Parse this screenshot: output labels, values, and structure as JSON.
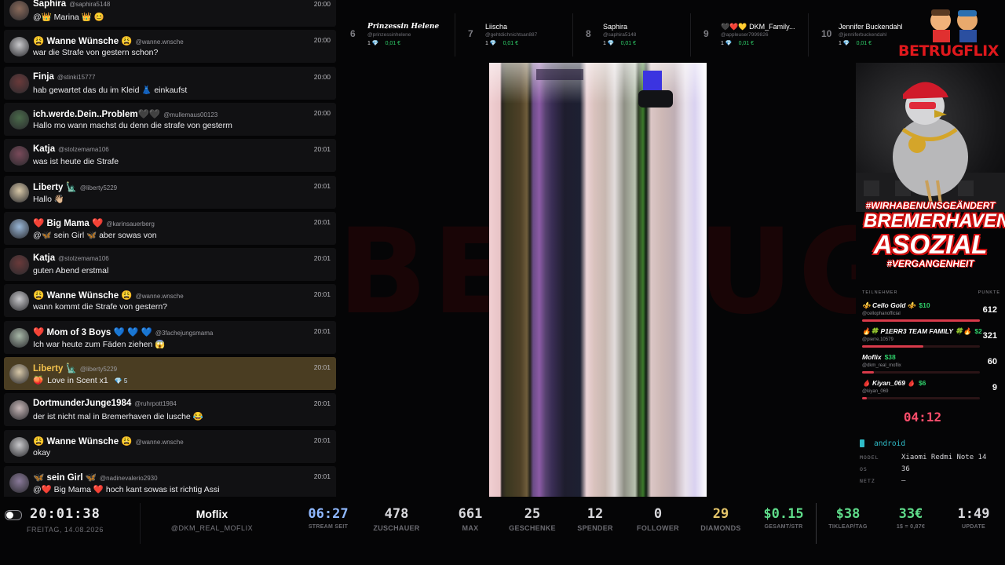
{
  "watermark": "BETRUGFLIX",
  "chat": [
    {
      "user": "Saphira",
      "handle": "@saphira5148",
      "time": "20:00",
      "text": "@👑 Marina 👑 😊"
    },
    {
      "user": "😩 Wanne Wünsche 😩",
      "handle": "@wanne.wnsche",
      "time": "20:00",
      "text": "war die Strafe von gestern schon?"
    },
    {
      "user": "Finja",
      "handle": "@stinki15777",
      "time": "20:00",
      "text": "hab gewartet das du im Kleid 👗 einkaufst"
    },
    {
      "user": "ich.werde.Dein..Problem🖤🖤",
      "handle": "@mullemaus00123",
      "time": "20:00",
      "text": "Hallo mo wann machst du denn die strafe von gesterm"
    },
    {
      "user": "Katja",
      "handle": "@stolzemama106",
      "time": "20:01",
      "text": "was ist heute die Strafe"
    },
    {
      "user": "Liberty 🗽",
      "handle": "@liberty5229",
      "time": "20:01",
      "text": "Hallo 👋🏼"
    },
    {
      "user": "❤️ Big Mama ❤️",
      "handle": "@karinsauerberg",
      "time": "20:01",
      "text": "@🦋 sein Girl 🦋 aber sowas von"
    },
    {
      "user": "Katja",
      "handle": "@stolzemama106",
      "time": "20:01",
      "text": "guten Abend erstmal"
    },
    {
      "user": "😩 Wanne Wünsche 😩",
      "handle": "@wanne.wnsche",
      "time": "20:01",
      "text": "wann kommt die Strafe von gestern?"
    },
    {
      "user": "❤️ Mom of 3 Boys 💙 💙 💙",
      "handle": "@3fachejungsmama",
      "time": "20:01",
      "text": "Ich war heute zum Fäden ziehen 😱"
    },
    {
      "user": "Liberty 🗽",
      "handle": "@liberty5229",
      "time": "20:01",
      "text": "Love in Scent x1",
      "gift": "🍑",
      "diamonds": "💎 5",
      "highlight": true
    },
    {
      "user": "DortmunderJunge1984",
      "handle": "@ruhrpott1984",
      "time": "20:01",
      "text": "der ist nicht mal in Bremerhaven die lusche 😂"
    },
    {
      "user": "😩 Wanne Wünsche 😩",
      "handle": "@wanne.wnsche",
      "time": "20:01",
      "text": "okay"
    },
    {
      "user": "🦋 sein Girl 🦋",
      "handle": "@nadinevalerio2930",
      "time": "20:01",
      "text": "@❤️ Big Mama ❤️ hoch kant sowas ist richtig Assi"
    }
  ],
  "leaderboard": [
    {
      "rank": "6",
      "name": "Prinzessin Helene",
      "handle": "@prinzessinhelene",
      "count": "1 💎",
      "amount": "0,01 €"
    },
    {
      "rank": "7",
      "name": "Liischa",
      "handle": "@gehtdichnichtsan887",
      "count": "1 💎",
      "amount": "0,01 €"
    },
    {
      "rank": "8",
      "name": "Saphira",
      "handle": "@saphira5148",
      "count": "1 💎",
      "amount": "0,01 €"
    },
    {
      "rank": "9",
      "name": "🖤❤️💛 DKM_Family...",
      "handle": "@appleuser7999826",
      "count": "1 💎",
      "amount": "0,01 €"
    },
    {
      "rank": "10",
      "name": "Jennifer Buckendahl",
      "handle": "@jenniferbuckendahl",
      "count": "1 💎",
      "amount": "0,01 €"
    }
  ],
  "brand": {
    "logo": "BETRUGFLIX"
  },
  "promo": {
    "hashtag1": "#WIRHABENUNSGEÄNDERT",
    "line1": "BREMERHAVEN",
    "line2": "ASOZIAL",
    "hashtag2": "#VERGANGENHEIT"
  },
  "participants": {
    "header_left": "TEILNEHMER",
    "header_right": "PUNKTE",
    "rows": [
      {
        "name": "⚜️ Cello Gold ⚜️",
        "usd": "$10",
        "handle": "@cellophanofficial",
        "points": "612",
        "fill": 1.0
      },
      {
        "name": "🔥🍀 P1ERR3 TEAM FAMILY 🍀🔥",
        "usd": "$2",
        "handle": "@pierre.10579",
        "points": "321",
        "fill": 0.52
      },
      {
        "name": "Moflix",
        "usd": "$38",
        "handle": "@dkm_real_moflix",
        "points": "60",
        "fill": 0.1
      },
      {
        "name": "🩸 Kiyan_069 🩸",
        "usd": "$6",
        "handle": "@kiyan_069",
        "points": "9",
        "fill": 0.04
      }
    ]
  },
  "timer": "04:12",
  "device": {
    "platform": "android",
    "model_label": "MODEL",
    "model": "Xiaomi Redmi Note 14",
    "os_label": "OS",
    "os": "36",
    "net_label": "NETZ",
    "net": "—"
  },
  "bottom": {
    "clock": "20:01:38",
    "date": "FREITAG, 14.08.2026",
    "streamer": "Moflix",
    "streamer_handle": "@DKM_REAL_MOFLIX",
    "stats": [
      {
        "value": "06:27",
        "label": "STREAM SEIT",
        "color": "#8fb8ff"
      },
      {
        "value": "478",
        "label": "ZUSCHAUER",
        "color": "#d8d8dc"
      },
      {
        "value": "661",
        "label": "MAX",
        "color": "#d8d8dc"
      },
      {
        "value": "25",
        "label": "GESCHENKE",
        "color": "#d8d8dc"
      },
      {
        "value": "12",
        "label": "SPENDER",
        "color": "#d8d8dc"
      },
      {
        "value": "0",
        "label": "FOLLOWER",
        "color": "#d8d8dc"
      },
      {
        "value": "29",
        "label": "DIAMONDS",
        "color": "#e5c66a"
      },
      {
        "value": "$0.15",
        "label": "GESAMT/STR",
        "color": "#5fdc8a"
      },
      {
        "value": "$38",
        "label": "TIKLEAP/TAG",
        "color": "#5fdc8a"
      },
      {
        "value": "33€",
        "label": "1$ = 0,87€",
        "color": "#5fdc8a"
      },
      {
        "value": "1:49",
        "label": "UPDATE",
        "color": "#d8d8dc"
      }
    ]
  }
}
